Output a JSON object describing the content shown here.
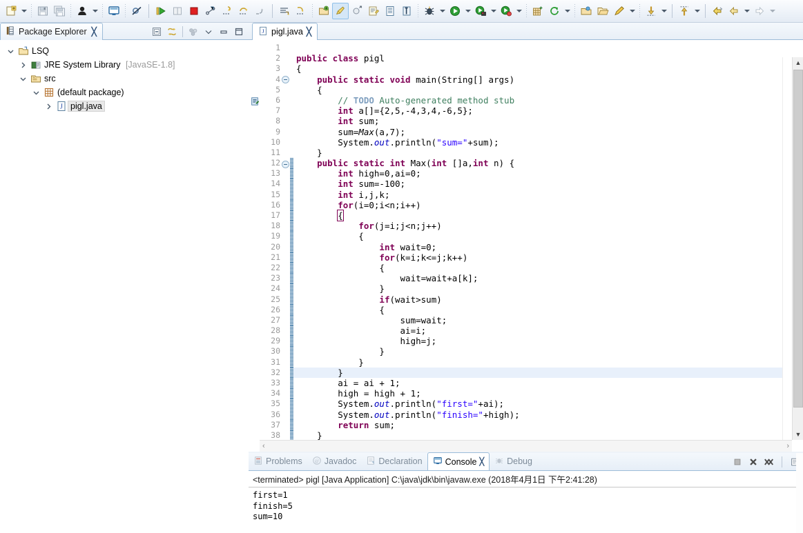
{
  "toolbar": {
    "groups": [
      {
        "items": [
          {
            "name": "new-wizard-icon",
            "label": "New"
          },
          {
            "name": "new-dropdown-arrow",
            "label": "New menu"
          }
        ]
      },
      {
        "items": [
          {
            "name": "save-icon",
            "label": "Save"
          },
          {
            "name": "save-all-icon",
            "label": "Save All"
          }
        ]
      },
      {
        "items": [
          {
            "name": "person-icon",
            "label": "User"
          },
          {
            "name": "person-dropdown-arrow",
            "label": "User menu"
          }
        ]
      },
      {
        "items": [
          {
            "name": "console-view-icon",
            "label": "Open Console"
          }
        ]
      },
      {
        "items": [
          {
            "name": "skip-breakpoints-icon",
            "label": "Skip All Breakpoints"
          }
        ]
      },
      {
        "items": [
          {
            "name": "resume-icon",
            "label": "Resume"
          },
          {
            "name": "suspend-icon",
            "label": "Suspend"
          },
          {
            "name": "terminate-icon",
            "label": "Terminate"
          },
          {
            "name": "disconnect-icon",
            "label": "Disconnect"
          },
          {
            "name": "step-into-icon",
            "label": "Step Into"
          },
          {
            "name": "step-over-icon",
            "label": "Step Over"
          },
          {
            "name": "step-return-icon",
            "label": "Step Return"
          }
        ]
      },
      {
        "items": [
          {
            "name": "next-annotation-icon",
            "label": "Next Annotation"
          },
          {
            "name": "previous-annotation-icon",
            "label": "Previous Annotation"
          }
        ]
      },
      {
        "items": [
          {
            "name": "new-java-project-icon",
            "label": "New Java Project"
          },
          {
            "name": "new-java-class-icon",
            "label": "New Java Class",
            "selected": true
          },
          {
            "name": "new-java-package-icon",
            "label": "New Java Package"
          },
          {
            "name": "new-annotation-icon",
            "label": "New Annotation"
          },
          {
            "name": "open-type-icon",
            "label": "Open Type"
          },
          {
            "name": "open-task-icon",
            "label": "Open Task"
          }
        ]
      },
      {
        "items": [
          {
            "name": "debug-icon",
            "label": "Debug"
          },
          {
            "name": "debug-dropdown-arrow",
            "label": "Debug History"
          },
          {
            "name": "run-icon",
            "label": "Run"
          },
          {
            "name": "run-dropdown-arrow",
            "label": "Run History"
          },
          {
            "name": "run-external-tools-icon",
            "label": "External Tools"
          },
          {
            "name": "external-tools-dropdown-arrow",
            "label": "External Tools History"
          },
          {
            "name": "coverage-icon",
            "label": "Coverage"
          },
          {
            "name": "coverage-dropdown-arrow",
            "label": "Coverage History"
          }
        ]
      },
      {
        "items": [
          {
            "name": "new-package-grid-icon",
            "label": "New Package"
          },
          {
            "name": "refresh-icon",
            "label": "Refresh"
          },
          {
            "name": "refresh-dropdown-arrow",
            "label": "Refresh menu"
          }
        ]
      },
      {
        "items": [
          {
            "name": "open-resource-icon",
            "label": "Open Resource"
          },
          {
            "name": "open-folder-icon",
            "label": "Open Folder"
          },
          {
            "name": "edit-pencil-icon",
            "label": "Edit"
          },
          {
            "name": "edit-dropdown-arrow",
            "label": "Edit menu"
          }
        ]
      },
      {
        "items": [
          {
            "name": "download-icon",
            "label": "Import"
          },
          {
            "name": "download-dropdown-arrow",
            "label": "Import menu"
          }
        ]
      },
      {
        "items": [
          {
            "name": "upload-icon",
            "label": "Export"
          },
          {
            "name": "upload-dropdown-arrow",
            "label": "Export menu"
          }
        ]
      },
      {
        "items": [
          {
            "name": "back-yellow-arrow-icon",
            "label": "Back"
          },
          {
            "name": "back-arrow-icon",
            "label": "Previous"
          },
          {
            "name": "back-dropdown-arrow",
            "label": "Back menu"
          },
          {
            "name": "forward-arrow-icon",
            "label": "Forward"
          },
          {
            "name": "forward-dropdown-arrow",
            "label": "Forward menu"
          }
        ]
      }
    ]
  },
  "package_explorer": {
    "tab_title": "Package Explorer",
    "close_glyph": "╳",
    "tools": [
      {
        "name": "collapse-all-icon",
        "label": "Collapse All"
      },
      {
        "name": "link-with-editor-icon",
        "label": "Link with Editor"
      },
      {
        "name": "view-menu-filter-icon",
        "label": "View Menu"
      },
      {
        "name": "chevron-down-icon",
        "label": "View Menu"
      },
      {
        "name": "minimize-icon",
        "label": "Minimize"
      },
      {
        "name": "maximize-icon",
        "label": "Maximize"
      }
    ],
    "tree": [
      {
        "label": "LSQ",
        "suffix": "",
        "indent": 0,
        "twist": "down",
        "icon": "project-icon",
        "selected": false
      },
      {
        "label": "JRE System Library",
        "suffix": "[JavaSE-1.8]",
        "indent": 1,
        "twist": "right",
        "icon": "library-icon",
        "selected": false
      },
      {
        "label": "src",
        "suffix": "",
        "indent": 1,
        "twist": "down",
        "icon": "source-folder-icon",
        "selected": false
      },
      {
        "label": "(default package)",
        "suffix": "",
        "indent": 2,
        "twist": "down",
        "icon": "package-icon",
        "selected": false
      },
      {
        "label": "pigl.java",
        "suffix": "",
        "indent": 3,
        "twist": "right",
        "icon": "java-file-icon",
        "selected": true
      }
    ]
  },
  "editor": {
    "tab_title": "pigl.java",
    "tab_icon": "java-file-icon",
    "close_glyph": "╳",
    "current_line": 32,
    "task_marker_line": 6,
    "fold_marker_lines": [
      4,
      12
    ],
    "bracket_match_line": 17,
    "change_bar_from_line": 12,
    "lines": [
      {
        "n": 1,
        "tokens": []
      },
      {
        "n": 2,
        "tokens": [
          {
            "t": "kw",
            "v": "public class "
          },
          {
            "t": "p",
            "v": "pigl"
          }
        ]
      },
      {
        "n": 3,
        "tokens": [
          {
            "t": "p",
            "v": "{"
          }
        ]
      },
      {
        "n": 4,
        "tokens": [
          {
            "t": "p",
            "v": "    "
          },
          {
            "t": "kw",
            "v": "public static void "
          },
          {
            "t": "p",
            "v": "main(String[] args)"
          }
        ]
      },
      {
        "n": 5,
        "tokens": [
          {
            "t": "p",
            "v": "    {"
          }
        ]
      },
      {
        "n": 6,
        "tokens": [
          {
            "t": "p",
            "v": "        "
          },
          {
            "t": "cmt",
            "v": "// "
          },
          {
            "t": "todo",
            "v": "TODO"
          },
          {
            "t": "cmt",
            "v": " Auto-generated method stub"
          }
        ]
      },
      {
        "n": 7,
        "tokens": [
          {
            "t": "p",
            "v": "        "
          },
          {
            "t": "kw",
            "v": "int "
          },
          {
            "t": "p",
            "v": "a[]={2,5,-4,3,4,-6,5};"
          }
        ]
      },
      {
        "n": 8,
        "tokens": [
          {
            "t": "p",
            "v": "        "
          },
          {
            "t": "kw",
            "v": "int "
          },
          {
            "t": "p",
            "v": "sum;"
          }
        ]
      },
      {
        "n": 9,
        "tokens": [
          {
            "t": "p",
            "v": "        sum="
          },
          {
            "t": "stat",
            "v": "Max"
          },
          {
            "t": "p",
            "v": "(a,7);"
          }
        ]
      },
      {
        "n": 10,
        "tokens": [
          {
            "t": "p",
            "v": "        System."
          },
          {
            "t": "fld",
            "v": "out"
          },
          {
            "t": "p",
            "v": ".println("
          },
          {
            "t": "str",
            "v": "\"sum=\""
          },
          {
            "t": "p",
            "v": "+sum);"
          }
        ]
      },
      {
        "n": 11,
        "tokens": [
          {
            "t": "p",
            "v": "    }"
          }
        ]
      },
      {
        "n": 12,
        "tokens": [
          {
            "t": "p",
            "v": "    "
          },
          {
            "t": "kw",
            "v": "public static int "
          },
          {
            "t": "p",
            "v": "Max("
          },
          {
            "t": "kw",
            "v": "int "
          },
          {
            "t": "p",
            "v": "[]a,"
          },
          {
            "t": "kw",
            "v": "int "
          },
          {
            "t": "p",
            "v": "n) {"
          }
        ]
      },
      {
        "n": 13,
        "tokens": [
          {
            "t": "p",
            "v": "        "
          },
          {
            "t": "kw",
            "v": "int "
          },
          {
            "t": "p",
            "v": "high=0,ai=0;"
          }
        ]
      },
      {
        "n": 14,
        "tokens": [
          {
            "t": "p",
            "v": "        "
          },
          {
            "t": "kw",
            "v": "int "
          },
          {
            "t": "p",
            "v": "sum=-100;"
          }
        ]
      },
      {
        "n": 15,
        "tokens": [
          {
            "t": "p",
            "v": "        "
          },
          {
            "t": "kw",
            "v": "int "
          },
          {
            "t": "p",
            "v": "i,j,k;"
          }
        ]
      },
      {
        "n": 16,
        "tokens": [
          {
            "t": "p",
            "v": "        "
          },
          {
            "t": "kw",
            "v": "for"
          },
          {
            "t": "p",
            "v": "(i=0;i<n;i++)"
          }
        ]
      },
      {
        "n": 17,
        "tokens": [
          {
            "t": "p",
            "v": "        "
          },
          {
            "t": "brk",
            "v": "{"
          }
        ]
      },
      {
        "n": 18,
        "tokens": [
          {
            "t": "p",
            "v": "            "
          },
          {
            "t": "kw",
            "v": "for"
          },
          {
            "t": "p",
            "v": "(j=i;j<n;j++)"
          }
        ]
      },
      {
        "n": 19,
        "tokens": [
          {
            "t": "p",
            "v": "            {"
          }
        ]
      },
      {
        "n": 20,
        "tokens": [
          {
            "t": "p",
            "v": "                "
          },
          {
            "t": "kw",
            "v": "int "
          },
          {
            "t": "p",
            "v": "wait=0;"
          }
        ]
      },
      {
        "n": 21,
        "tokens": [
          {
            "t": "p",
            "v": "                "
          },
          {
            "t": "kw",
            "v": "for"
          },
          {
            "t": "p",
            "v": "(k=i;k<=j;k++)"
          }
        ]
      },
      {
        "n": 22,
        "tokens": [
          {
            "t": "p",
            "v": "                {"
          }
        ]
      },
      {
        "n": 23,
        "tokens": [
          {
            "t": "p",
            "v": "                    wait=wait+a[k];"
          }
        ]
      },
      {
        "n": 24,
        "tokens": [
          {
            "t": "p",
            "v": "                }"
          }
        ]
      },
      {
        "n": 25,
        "tokens": [
          {
            "t": "p",
            "v": "                "
          },
          {
            "t": "kw",
            "v": "if"
          },
          {
            "t": "p",
            "v": "(wait>sum)"
          }
        ]
      },
      {
        "n": 26,
        "tokens": [
          {
            "t": "p",
            "v": "                {"
          }
        ]
      },
      {
        "n": 27,
        "tokens": [
          {
            "t": "p",
            "v": "                    sum=wait;"
          }
        ]
      },
      {
        "n": 28,
        "tokens": [
          {
            "t": "p",
            "v": "                    ai=i;"
          }
        ]
      },
      {
        "n": 29,
        "tokens": [
          {
            "t": "p",
            "v": "                    high=j;"
          }
        ]
      },
      {
        "n": 30,
        "tokens": [
          {
            "t": "p",
            "v": "                }"
          }
        ]
      },
      {
        "n": 31,
        "tokens": [
          {
            "t": "p",
            "v": "            }"
          }
        ]
      },
      {
        "n": 32,
        "tokens": [
          {
            "t": "p",
            "v": "        }"
          }
        ]
      },
      {
        "n": 33,
        "tokens": [
          {
            "t": "p",
            "v": "        ai = ai + 1;"
          }
        ]
      },
      {
        "n": 34,
        "tokens": [
          {
            "t": "p",
            "v": "        high = high + 1;"
          }
        ]
      },
      {
        "n": 35,
        "tokens": [
          {
            "t": "p",
            "v": "        System."
          },
          {
            "t": "fld",
            "v": "out"
          },
          {
            "t": "p",
            "v": ".println("
          },
          {
            "t": "str",
            "v": "\"first=\""
          },
          {
            "t": "p",
            "v": "+ai);"
          }
        ]
      },
      {
        "n": 36,
        "tokens": [
          {
            "t": "p",
            "v": "        System."
          },
          {
            "t": "fld",
            "v": "out"
          },
          {
            "t": "p",
            "v": ".println("
          },
          {
            "t": "str",
            "v": "\"finish=\""
          },
          {
            "t": "p",
            "v": "+high);"
          }
        ]
      },
      {
        "n": 37,
        "tokens": [
          {
            "t": "p",
            "v": "        "
          },
          {
            "t": "kw",
            "v": "return "
          },
          {
            "t": "p",
            "v": "sum;"
          }
        ]
      },
      {
        "n": 38,
        "tokens": [
          {
            "t": "p",
            "v": "    }"
          }
        ]
      }
    ],
    "hscroll_left_glyph": "‹",
    "hscroll_right_glyph": "›",
    "vscroll_up_glyph": "▲",
    "vscroll_down_glyph": "▼"
  },
  "bottom_panel": {
    "tabs": [
      {
        "label": "Problems",
        "icon": "problems-icon",
        "active": false
      },
      {
        "label": "Javadoc",
        "icon": "javadoc-icon",
        "active": false
      },
      {
        "label": "Declaration",
        "icon": "declaration-icon",
        "active": false
      },
      {
        "label": "Console",
        "icon": "console-icon",
        "active": true
      },
      {
        "label": "Debug",
        "icon": "debug-icon",
        "active": false
      }
    ],
    "close_glyph": "╳",
    "tools": [
      {
        "name": "terminate-console-icon",
        "label": "Terminate"
      },
      {
        "name": "remove-launch-icon",
        "label": "Remove Launch"
      },
      {
        "name": "remove-all-launches-icon",
        "label": "Remove All Terminated Launches"
      },
      {
        "name": "console-options-icon",
        "label": "Open Console"
      }
    ],
    "console": {
      "header": "<terminated> pigl [Java Application] C:\\java\\jdk\\bin\\javaw.exe (2018年4月1日 下午2:41:28)",
      "output": [
        "first=1",
        "finish=5",
        "sum=10"
      ]
    }
  },
  "colors": {
    "keyword": "#7f0055",
    "string": "#2a00ff",
    "comment": "#3f7f5f",
    "todo_tag": "#7f9fbf",
    "field": "#0000c0",
    "current_line": "#e8f0fb",
    "tab_border": "#9dbcd8",
    "toolbar_bg": "#eef3f9"
  }
}
